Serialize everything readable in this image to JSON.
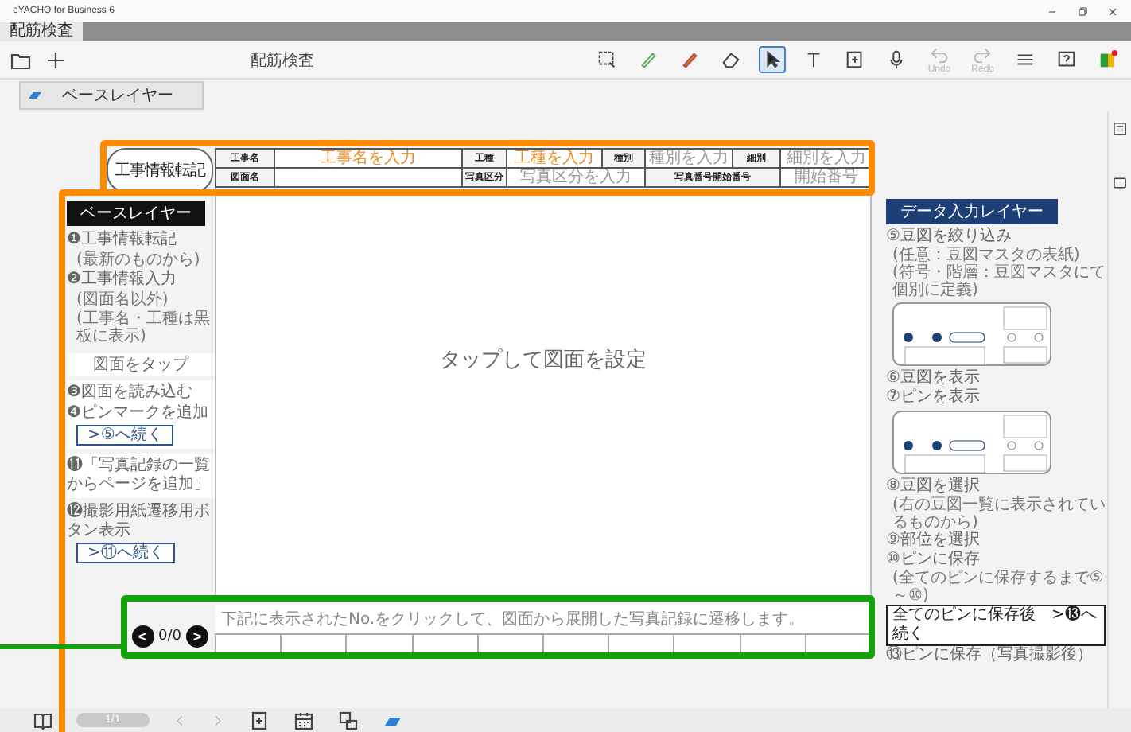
{
  "window": {
    "title": "eYACHO for Business 6"
  },
  "tabs": [
    {
      "label": "配筋検査",
      "selected": true
    }
  ],
  "toolbar": {
    "title": "配筋検査",
    "tools": [
      {
        "selected": false
      },
      {
        "selected": false
      },
      {
        "selected": false
      },
      {
        "selected": false
      },
      {
        "selected": true
      },
      {
        "selected": false
      },
      {
        "selected": false
      },
      {
        "selected": false
      },
      {
        "label": "Undo",
        "disabled": true
      },
      {
        "label": "Redo",
        "disabled": true
      },
      {
        "selected": false
      },
      {
        "selected": false
      },
      {
        "selected": false
      }
    ]
  },
  "layer_button": {
    "label": "ベースレイヤー"
  },
  "transfer_button": {
    "label": "工事情報転記"
  },
  "header_table": {
    "rows": [
      [
        {
          "kind": "label",
          "text": "工事名"
        },
        {
          "kind": "value",
          "text": "工事名を入力"
        },
        {
          "kind": "label",
          "text": "工種"
        },
        {
          "kind": "value",
          "text": "工種を入力"
        },
        {
          "kind": "label",
          "text": "種別"
        },
        {
          "kind": "hint",
          "text": "種別を入力"
        },
        {
          "kind": "label",
          "text": "細別"
        },
        {
          "kind": "hint",
          "text": "細別を入力"
        }
      ],
      [
        {
          "kind": "label",
          "text": "図面名"
        },
        {
          "kind": "field"
        },
        {
          "kind": "label",
          "text": "写真区分"
        },
        {
          "kind": "hint",
          "text": "写真区分を入力",
          "colspan": 2
        },
        {
          "kind": "label",
          "text": "写真番号開始番号",
          "colspan": 2
        },
        {
          "kind": "hint",
          "text": "開始番号"
        }
      ]
    ]
  },
  "base_layer": {
    "title": "ベースレイヤー",
    "notes": [
      {
        "kind": "step",
        "text": "❶工事情報転記"
      },
      {
        "kind": "sub",
        "text": "(最新のものから)"
      },
      {
        "kind": "step",
        "text": "❷工事情報入力"
      },
      {
        "kind": "sub",
        "text": "(図面名以外)"
      },
      {
        "kind": "sub",
        "text": "(工事名・工種は黒板に表示)"
      },
      {
        "kind": "heading",
        "text": "図面をタップ"
      },
      {
        "kind": "panel",
        "items": [
          {
            "kind": "step",
            "text": "❸図面を読み込む"
          },
          {
            "kind": "step",
            "text": "❹ピンマークを追加"
          },
          {
            "kind": "link",
            "text": ">⑤へ続く"
          }
        ]
      },
      {
        "kind": "panel",
        "items": [
          {
            "kind": "step",
            "text": "⓫「写真記録の一覧からページを追加」"
          }
        ]
      },
      {
        "kind": "step",
        "text": "⓬撮影用紙遷移用ボタン表示"
      },
      {
        "kind": "link",
        "text": ">⑪へ続く"
      }
    ]
  },
  "canvas": {
    "prompt": "タップして図面を設定"
  },
  "pin_bar": {
    "hint": "下記に表示されたNo.をクリックして、図面から展開した写真記録に遷移します。",
    "prev": "<",
    "count": "0/0",
    "next": ">"
  },
  "data_layer": {
    "title": "データ入力レイヤー",
    "notes": [
      {
        "kind": "step",
        "text": "⑤豆図を絞り込み"
      },
      {
        "kind": "sub",
        "text": "(任意：豆図マスタの表紙)"
      },
      {
        "kind": "sub",
        "text": "(符号・階層：豆図マスタにて個別に定義)"
      },
      {
        "kind": "thumbnail"
      },
      {
        "kind": "step",
        "text": "⑥豆図を表示"
      },
      {
        "kind": "step",
        "text": "⑦ピンを表示"
      },
      {
        "kind": "thumbnail"
      },
      {
        "kind": "step",
        "text": "⑧豆図を選択"
      },
      {
        "kind": "sub",
        "text": "(右の豆図一覧に表示されているものから)"
      },
      {
        "kind": "step",
        "text": "⑨部位を選択"
      },
      {
        "kind": "step",
        "text": "⑩ピンに保存"
      },
      {
        "kind": "sub",
        "text": "(全てのピンに保存するまで⑤～⑩)"
      },
      {
        "kind": "boxed",
        "text": "全てのピンに保存後　>⓭へ続く"
      },
      {
        "kind": "step",
        "text": "⑬ピンに保存（写真撮影後）"
      }
    ]
  },
  "page_nav": {
    "page": "1/1"
  }
}
